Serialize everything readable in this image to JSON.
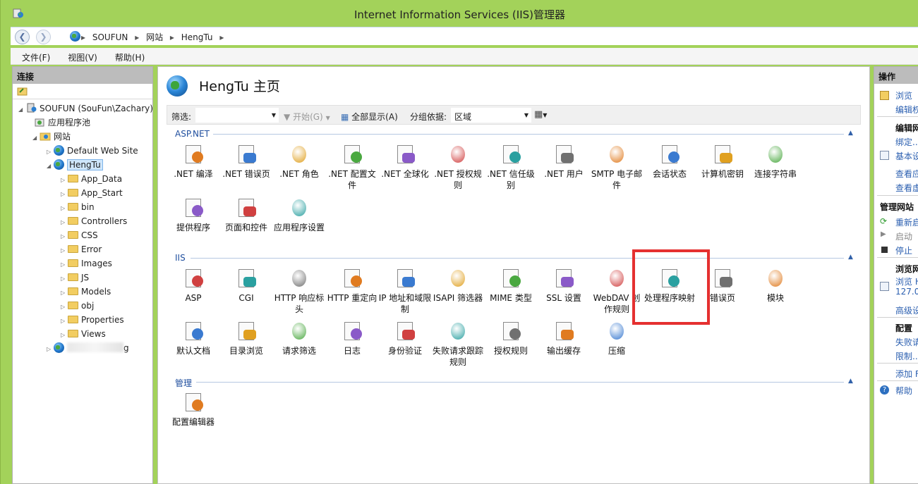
{
  "window": {
    "title": "Internet Information Services (IIS)管理器"
  },
  "address": {
    "crumbs": [
      "SOUFUN",
      "网站",
      "HengTu"
    ]
  },
  "menu": {
    "file": "文件(F)",
    "view": "视图(V)",
    "help": "帮助(H)"
  },
  "left": {
    "title": "连接",
    "server": "SOUFUN (SouFun\\Zachary)",
    "app_pools": "应用程序池",
    "sites": "网站",
    "default_site": "Default Web Site",
    "hengtu": "HengTu",
    "folders": [
      "App_Data",
      "App_Start",
      "bin",
      "Controllers",
      "CSS",
      "Error",
      "Images",
      "JS",
      "Models",
      "obj",
      "Properties",
      "Views"
    ],
    "redacted_site_tail": "g"
  },
  "center": {
    "title": "HengTu 主页",
    "filter_label": "筛选:",
    "start_label": "开始(G)",
    "show_all": "全部显示(A)",
    "group_label": "分组依据:",
    "group_value": "区域",
    "sections": {
      "aspnet": "ASP.NET",
      "iis": "IIS",
      "manage": "管理"
    },
    "aspnet_features": [
      ".NET 编泽",
      ".NET 错误页",
      ".NET 角色",
      ".NET 配置文件",
      ".NET 全球化",
      ".NET 授权规则",
      ".NET 信任级别",
      ".NET 用户",
      "SMTP 电子邮件",
      "会话状态",
      "计算机密钥",
      "连接字符串",
      "提供程序",
      "页面和控件",
      "应用程序设置"
    ],
    "iis_features": [
      "ASP",
      "CGI",
      "HTTP 响应标头",
      "HTTP 重定向",
      "IP 地址和域限制",
      "ISAPI 筛选器",
      "MIME 类型",
      "SSL 设置",
      "WebDAV 创作规则",
      "处理程序映射",
      "错误页",
      "模块",
      "默认文档",
      "目录浏览",
      "请求筛选",
      "日志",
      "身份验证",
      "失败请求跟踪规则",
      "授权规则",
      "输出缓存",
      "压缩"
    ],
    "manage_features": [
      "配置编辑器"
    ]
  },
  "right": {
    "title": "操作",
    "browse": "浏览",
    "edit_perm": "编辑权",
    "edit_site": "编辑网",
    "bindings": "绑定...",
    "basic": "基本设",
    "view_app": "查看应",
    "view_vdir": "查看虚",
    "manage_site": "管理网站",
    "restart": "重新启",
    "start": "启动",
    "stop": "停止",
    "browse_site": "浏览网",
    "browse_h": "浏览 H",
    "ip": "127.0.",
    "advanced": "高级设",
    "config": "配置",
    "failed": "失败请",
    "limits": "限制...",
    "add": "添加 F",
    "help": "帮助"
  },
  "colors": {
    "titlebar": "#a3d25a",
    "highlight": "#e53030",
    "section": "#1f4e9e"
  }
}
